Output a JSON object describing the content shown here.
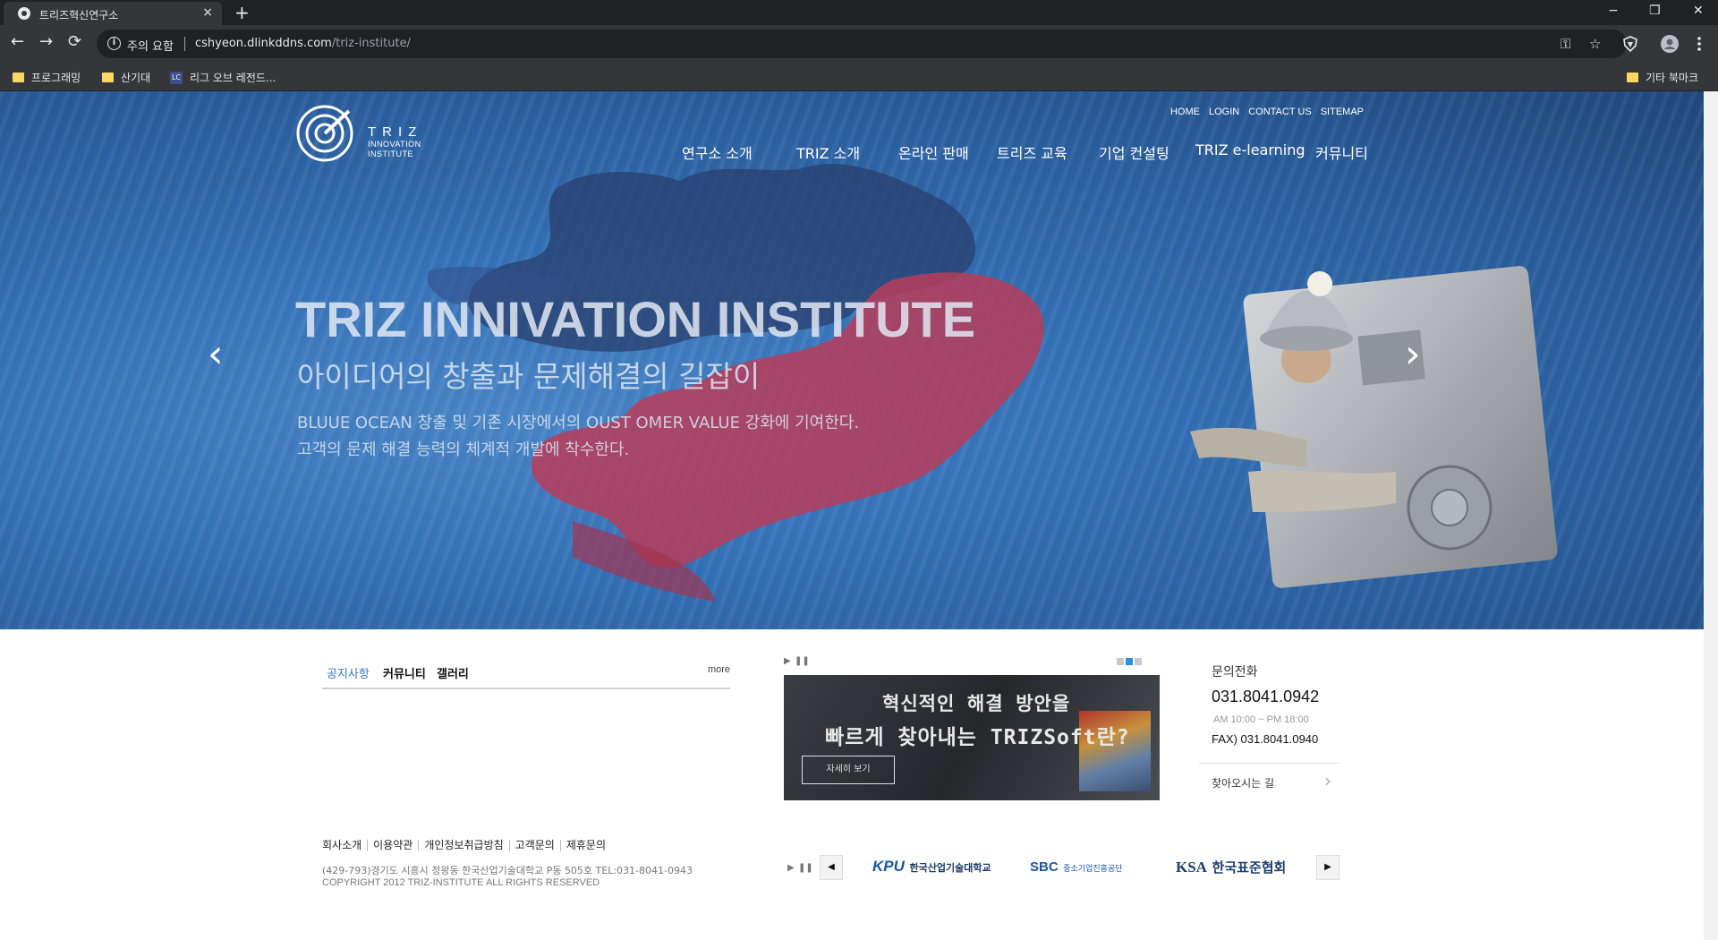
{
  "browser": {
    "tab_title": "트리즈혁신연구소",
    "tab_close": "×",
    "new_tab": "+",
    "window_controls": {
      "minimize": "−",
      "restore": "❐",
      "close": "✕"
    },
    "nav": {
      "back": "←",
      "forward": "→",
      "reload": "⟳"
    },
    "security_label": "주의 요함",
    "url_host": "cshyeon.dlinkddns.com",
    "url_path": "/triz-institute/",
    "omnibox_icons": {
      "key": "⚿",
      "star": "☆"
    },
    "bookmarks": [
      {
        "label": "프로그래밍",
        "icon": "folder-icon"
      },
      {
        "label": "산기대",
        "icon": "folder-icon"
      },
      {
        "label": "리그 오브 레전드...",
        "icon": "lol-icon"
      }
    ],
    "other_bookmarks": "기타 북마크"
  },
  "site": {
    "logo": {
      "line1": "TRIZ",
      "line2": "INNOVATION",
      "line3": "INSTITUTE"
    },
    "top_nav": [
      "HOME",
      "LOGIN",
      "CONTACT US",
      "SITEMAP"
    ],
    "main_nav": [
      "연구소 소개",
      "TRIZ 소개",
      "온라인 판매",
      "트리즈 교육",
      "기업 컨설팅",
      "TRIZ e-learning",
      "커뮤니티"
    ],
    "hero": {
      "title": "TRIZ INNIVATION INSTITUTE",
      "subtitle": "아이디어의 창출과 문제해결의 길잡이",
      "desc1": "BLUUE OCEAN 창출 및 기존 시장에서의 OUST OMER VALUE 강화에 기여한다.",
      "desc2": "고객의 문제 해결 능력의 체계적 개발에 착수한다.",
      "prev": "‹",
      "next": "›"
    },
    "board": {
      "tabs": [
        "공지사항",
        "커뮤니티",
        "갤러리"
      ],
      "more": "more"
    },
    "banner": {
      "play": "▶",
      "pause": "❚❚",
      "line1": "혁신적인 해결 방안을",
      "line2": "빠르게 찾아내는 TRIZSoft란?",
      "button": "자세히 보기"
    },
    "contact": {
      "title": "문의전화",
      "phone": "031.8041.0942",
      "hours": "AM 10:00 ~ PM 18:00",
      "fax": "FAX) 031.8041.0940",
      "directions": "찾아오시는 길",
      "arrow": "›"
    },
    "footer": {
      "links": [
        "회사소개",
        "이용약관",
        "개인정보취급방침",
        "고객문의",
        "제휴문의"
      ],
      "address": "(429-793)경기도 시흥시 정왕동 한국산업기술대학교 P동 505호 TEL:031-8041-0943",
      "copyright": "COPYRIGHT 2012 TRIZ-INSTITUTE ALL RIGHTS RESERVED"
    },
    "partners": {
      "prev": "◀",
      "next": "▶",
      "kpu": {
        "mark": "KPU",
        "name": "한국산업기술대학교"
      },
      "sbc": {
        "mark": "SBC",
        "name": "중소기업진흥공단"
      },
      "ksa": {
        "mark": "KSA",
        "name": "한국표준협회"
      }
    }
  }
}
